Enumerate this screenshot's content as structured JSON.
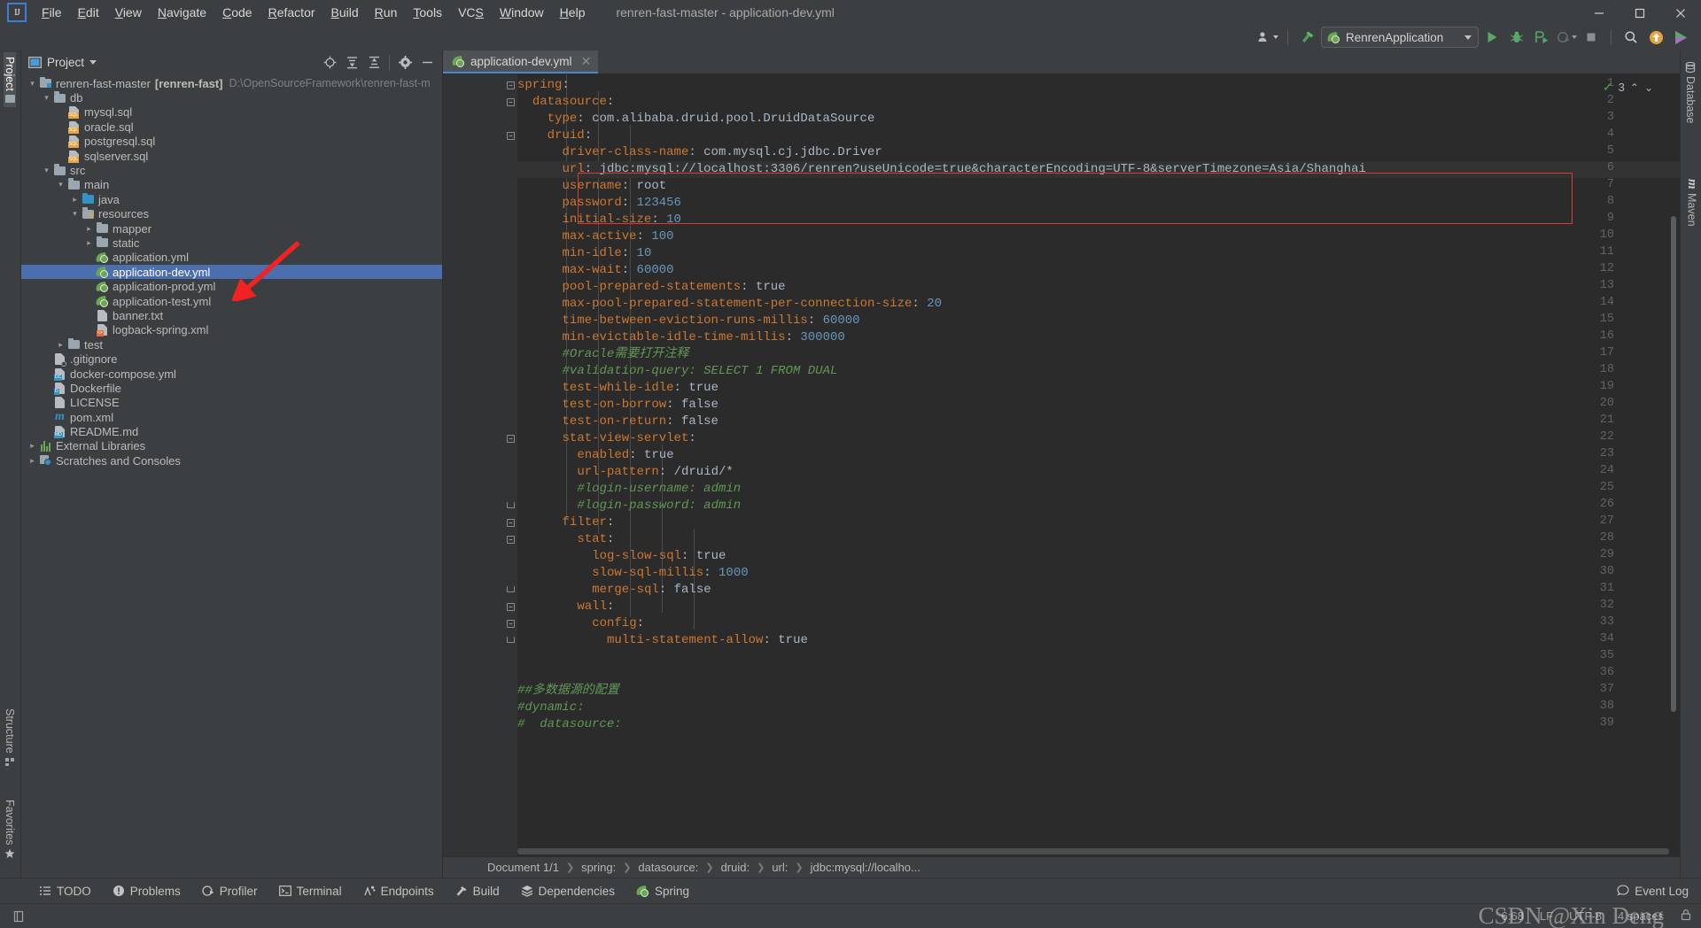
{
  "window": {
    "title": "renren-fast-master - application-dev.yml",
    "minimize": "─",
    "maximize": "☐",
    "close": "✕"
  },
  "menu": {
    "items": [
      "File",
      "Edit",
      "View",
      "Navigate",
      "Code",
      "Refactor",
      "Build",
      "Run",
      "Tools",
      "VCS",
      "Window",
      "Help"
    ]
  },
  "navbar": {
    "crumbs": [
      "renren-fast-master",
      "src",
      "main",
      "resources",
      "application-dev.yml"
    ]
  },
  "toolbar": {
    "run_config": "RenrenApplication",
    "icons": [
      "user-settings-icon",
      "hammer-build-icon",
      "run-icon",
      "debug-icon",
      "run-coverage-icon",
      "profile-icon",
      "stop-icon",
      "search-everywhere-icon",
      "update-icon",
      "ide-assistant-icon"
    ]
  },
  "left_strip": {
    "project": "Project",
    "structure": "Structure",
    "favorites": "Favorites"
  },
  "right_strip": {
    "database": "Database",
    "maven": "Maven"
  },
  "project_panel": {
    "title": "Project",
    "toolbar_icons": [
      "locate-icon",
      "expand-all-icon",
      "collapse-all-icon",
      "settings-gear-icon",
      "hide-icon"
    ],
    "tree": [
      {
        "indent": 0,
        "arrow": "down",
        "icon": "module-icon",
        "label": "renren-fast-master",
        "bold": "[renren-fast]",
        "path": "D:\\OpenSourceFramework\\renren-fast-m"
      },
      {
        "indent": 1,
        "arrow": "down",
        "icon": "folder-icon",
        "label": "db"
      },
      {
        "indent": 2,
        "arrow": "none",
        "icon": "sql-file-icon",
        "label": "mysql.sql"
      },
      {
        "indent": 2,
        "arrow": "none",
        "icon": "sql-file-icon",
        "label": "oracle.sql"
      },
      {
        "indent": 2,
        "arrow": "none",
        "icon": "sql-file-icon",
        "label": "postgresql.sql"
      },
      {
        "indent": 2,
        "arrow": "none",
        "icon": "sql-file-icon",
        "label": "sqlserver.sql"
      },
      {
        "indent": 1,
        "arrow": "down",
        "icon": "folder-icon",
        "label": "src"
      },
      {
        "indent": 2,
        "arrow": "down",
        "icon": "folder-icon",
        "label": "main"
      },
      {
        "indent": 3,
        "arrow": "right",
        "icon": "source-folder-icon",
        "label": "java"
      },
      {
        "indent": 3,
        "arrow": "down",
        "icon": "resource-folder-icon",
        "label": "resources"
      },
      {
        "indent": 4,
        "arrow": "right",
        "icon": "folder-icon",
        "label": "mapper"
      },
      {
        "indent": 4,
        "arrow": "right",
        "icon": "folder-icon",
        "label": "static"
      },
      {
        "indent": 4,
        "arrow": "none",
        "icon": "spring-yaml-icon",
        "label": "application.yml"
      },
      {
        "indent": 4,
        "arrow": "none",
        "icon": "spring-yaml-icon",
        "label": "application-dev.yml",
        "selected": true
      },
      {
        "indent": 4,
        "arrow": "none",
        "icon": "spring-yaml-icon",
        "label": "application-prod.yml"
      },
      {
        "indent": 4,
        "arrow": "none",
        "icon": "spring-yaml-icon",
        "label": "application-test.yml"
      },
      {
        "indent": 4,
        "arrow": "none",
        "icon": "text-file-icon",
        "label": "banner.txt"
      },
      {
        "indent": 4,
        "arrow": "none",
        "icon": "xml-file-icon",
        "label": "logback-spring.xml"
      },
      {
        "indent": 2,
        "arrow": "right",
        "icon": "folder-icon",
        "label": "test"
      },
      {
        "indent": 1,
        "arrow": "none",
        "icon": "gitignore-file-icon",
        "label": ".gitignore"
      },
      {
        "indent": 1,
        "arrow": "none",
        "icon": "docker-compose-file-icon",
        "label": "docker-compose.yml"
      },
      {
        "indent": 1,
        "arrow": "none",
        "icon": "dockerfile-icon",
        "label": "Dockerfile"
      },
      {
        "indent": 1,
        "arrow": "none",
        "icon": "license-file-icon",
        "label": "LICENSE"
      },
      {
        "indent": 1,
        "arrow": "none",
        "icon": "maven-pom-icon",
        "label": "pom.xml"
      },
      {
        "indent": 1,
        "arrow": "none",
        "icon": "markdown-file-icon",
        "label": "README.md"
      },
      {
        "indent": 0,
        "arrow": "right",
        "icon": "libraries-icon",
        "label": "External Libraries"
      },
      {
        "indent": 0,
        "arrow": "right",
        "icon": "scratches-icon",
        "label": "Scratches and Consoles"
      }
    ]
  },
  "editor": {
    "tab": "application-dev.yml",
    "tab_close": "✕",
    "inspection_count": "3",
    "lines": [
      {
        "n": 1,
        "fold": "minus",
        "indent": 0,
        "tokens": [
          {
            "t": "spring",
            "c": "k"
          },
          {
            "t": ":",
            "c": "p"
          }
        ]
      },
      {
        "n": 2,
        "fold": "minus",
        "indent": 2,
        "tokens": [
          {
            "t": "datasource",
            "c": "k"
          },
          {
            "t": ":",
            "c": "p"
          }
        ]
      },
      {
        "n": 3,
        "fold": "",
        "indent": 4,
        "tokens": [
          {
            "t": "type",
            "c": "k"
          },
          {
            "t": ": ",
            "c": "p"
          },
          {
            "t": "com.alibaba.druid.pool.DruidDataSource",
            "c": "v"
          }
        ]
      },
      {
        "n": 4,
        "fold": "minus",
        "indent": 4,
        "tokens": [
          {
            "t": "druid",
            "c": "k"
          },
          {
            "t": ":",
            "c": "p"
          }
        ]
      },
      {
        "n": 5,
        "fold": "",
        "indent": 6,
        "tokens": [
          {
            "t": "driver-class-name",
            "c": "k"
          },
          {
            "t": ": ",
            "c": "p"
          },
          {
            "t": "com.mysql.cj.jdbc.Driver",
            "c": "v"
          }
        ]
      },
      {
        "n": 6,
        "fold": "",
        "indent": 6,
        "current": true,
        "tokens": [
          {
            "t": "url",
            "c": "k"
          },
          {
            "t": ": ",
            "c": "p"
          },
          {
            "t": "jdbc:mysql://localhost:3306/renren?useUnicode=true&characterEncoding=UTF-8&serverTimezone=Asia/Shanghai",
            "c": "v"
          }
        ]
      },
      {
        "n": 7,
        "fold": "",
        "indent": 6,
        "tokens": [
          {
            "t": "username",
            "c": "k"
          },
          {
            "t": ": ",
            "c": "p"
          },
          {
            "t": "root",
            "c": "v"
          }
        ]
      },
      {
        "n": 8,
        "fold": "",
        "indent": 6,
        "tokens": [
          {
            "t": "password",
            "c": "k"
          },
          {
            "t": ": ",
            "c": "p"
          },
          {
            "t": "123456",
            "c": "n"
          }
        ]
      },
      {
        "n": 9,
        "fold": "",
        "indent": 6,
        "tokens": [
          {
            "t": "initial-size",
            "c": "k"
          },
          {
            "t": ": ",
            "c": "p"
          },
          {
            "t": "10",
            "c": "n"
          }
        ]
      },
      {
        "n": 10,
        "fold": "",
        "indent": 6,
        "tokens": [
          {
            "t": "max-active",
            "c": "k"
          },
          {
            "t": ": ",
            "c": "p"
          },
          {
            "t": "100",
            "c": "n"
          }
        ]
      },
      {
        "n": 11,
        "fold": "",
        "indent": 6,
        "tokens": [
          {
            "t": "min-idle",
            "c": "k"
          },
          {
            "t": ": ",
            "c": "p"
          },
          {
            "t": "10",
            "c": "n"
          }
        ]
      },
      {
        "n": 12,
        "fold": "",
        "indent": 6,
        "tokens": [
          {
            "t": "max-wait",
            "c": "k"
          },
          {
            "t": ": ",
            "c": "p"
          },
          {
            "t": "60000",
            "c": "n"
          }
        ]
      },
      {
        "n": 13,
        "fold": "",
        "indent": 6,
        "tokens": [
          {
            "t": "pool-prepared-statements",
            "c": "k"
          },
          {
            "t": ": ",
            "c": "p"
          },
          {
            "t": "true",
            "c": "v"
          }
        ]
      },
      {
        "n": 14,
        "fold": "",
        "indent": 6,
        "tokens": [
          {
            "t": "max-pool-prepared-statement-per-connection-size",
            "c": "k"
          },
          {
            "t": ": ",
            "c": "p"
          },
          {
            "t": "20",
            "c": "n"
          }
        ]
      },
      {
        "n": 15,
        "fold": "",
        "indent": 6,
        "tokens": [
          {
            "t": "time-between-eviction-runs-millis",
            "c": "k"
          },
          {
            "t": ": ",
            "c": "p"
          },
          {
            "t": "60000",
            "c": "n"
          }
        ]
      },
      {
        "n": 16,
        "fold": "",
        "indent": 6,
        "tokens": [
          {
            "t": "min-evictable-idle-time-millis",
            "c": "k"
          },
          {
            "t": ": ",
            "c": "p"
          },
          {
            "t": "300000",
            "c": "n"
          }
        ]
      },
      {
        "n": 17,
        "fold": "",
        "indent": 6,
        "tokens": [
          {
            "t": "#Oracle需要打开注释",
            "c": "c"
          }
        ]
      },
      {
        "n": 18,
        "fold": "",
        "indent": 6,
        "tokens": [
          {
            "t": "#validation-query: SELECT 1 FROM DUAL",
            "c": "c"
          }
        ]
      },
      {
        "n": 19,
        "fold": "",
        "indent": 6,
        "tokens": [
          {
            "t": "test-while-idle",
            "c": "k"
          },
          {
            "t": ": ",
            "c": "p"
          },
          {
            "t": "true",
            "c": "v"
          }
        ]
      },
      {
        "n": 20,
        "fold": "",
        "indent": 6,
        "tokens": [
          {
            "t": "test-on-borrow",
            "c": "k"
          },
          {
            "t": ": ",
            "c": "p"
          },
          {
            "t": "false",
            "c": "v"
          }
        ]
      },
      {
        "n": 21,
        "fold": "",
        "indent": 6,
        "tokens": [
          {
            "t": "test-on-return",
            "c": "k"
          },
          {
            "t": ": ",
            "c": "p"
          },
          {
            "t": "false",
            "c": "v"
          }
        ]
      },
      {
        "n": 22,
        "fold": "minus",
        "indent": 6,
        "tokens": [
          {
            "t": "stat-view-servlet",
            "c": "k"
          },
          {
            "t": ":",
            "c": "p"
          }
        ]
      },
      {
        "n": 23,
        "fold": "",
        "indent": 8,
        "tokens": [
          {
            "t": "enabled",
            "c": "k"
          },
          {
            "t": ": ",
            "c": "p"
          },
          {
            "t": "true",
            "c": "v"
          }
        ]
      },
      {
        "n": 24,
        "fold": "",
        "indent": 8,
        "tokens": [
          {
            "t": "url-pattern",
            "c": "k"
          },
          {
            "t": ": ",
            "c": "p"
          },
          {
            "t": "/druid/*",
            "c": "v"
          }
        ]
      },
      {
        "n": 25,
        "fold": "",
        "indent": 8,
        "tokens": [
          {
            "t": "#login-username: admin",
            "c": "c"
          }
        ]
      },
      {
        "n": 26,
        "fold": "end",
        "indent": 8,
        "tokens": [
          {
            "t": "#login-password: admin",
            "c": "c"
          }
        ]
      },
      {
        "n": 27,
        "fold": "minus",
        "indent": 6,
        "tokens": [
          {
            "t": "filter",
            "c": "k"
          },
          {
            "t": ":",
            "c": "p"
          }
        ]
      },
      {
        "n": 28,
        "fold": "minus",
        "indent": 8,
        "tokens": [
          {
            "t": "stat",
            "c": "k"
          },
          {
            "t": ":",
            "c": "p"
          }
        ]
      },
      {
        "n": 29,
        "fold": "",
        "indent": 10,
        "tokens": [
          {
            "t": "log-slow-sql",
            "c": "k"
          },
          {
            "t": ": ",
            "c": "p"
          },
          {
            "t": "true",
            "c": "v"
          }
        ]
      },
      {
        "n": 30,
        "fold": "",
        "indent": 10,
        "tokens": [
          {
            "t": "slow-sql-millis",
            "c": "k"
          },
          {
            "t": ": ",
            "c": "p"
          },
          {
            "t": "1000",
            "c": "n"
          }
        ]
      },
      {
        "n": 31,
        "fold": "end",
        "indent": 10,
        "tokens": [
          {
            "t": "merge-sql",
            "c": "k"
          },
          {
            "t": ": ",
            "c": "p"
          },
          {
            "t": "false",
            "c": "v"
          }
        ]
      },
      {
        "n": 32,
        "fold": "minus",
        "indent": 8,
        "tokens": [
          {
            "t": "wall",
            "c": "k"
          },
          {
            "t": ":",
            "c": "p"
          }
        ]
      },
      {
        "n": 33,
        "fold": "minus",
        "indent": 10,
        "tokens": [
          {
            "t": "config",
            "c": "k"
          },
          {
            "t": ":",
            "c": "p"
          }
        ]
      },
      {
        "n": 34,
        "fold": "end",
        "indent": 12,
        "tokens": [
          {
            "t": "multi-statement-allow",
            "c": "k"
          },
          {
            "t": ": ",
            "c": "p"
          },
          {
            "t": "true",
            "c": "v"
          }
        ]
      },
      {
        "n": 35,
        "fold": "",
        "indent": 0,
        "tokens": []
      },
      {
        "n": 36,
        "fold": "",
        "indent": 0,
        "tokens": []
      },
      {
        "n": 37,
        "fold": "",
        "indent": 0,
        "tokens": [
          {
            "t": "##多数据源的配置",
            "c": "c"
          }
        ]
      },
      {
        "n": 38,
        "fold": "",
        "indent": 0,
        "tokens": [
          {
            "t": "#dynamic:",
            "c": "c"
          }
        ]
      },
      {
        "n": 39,
        "fold": "",
        "indent": 0,
        "tokens": [
          {
            "t": "#  datasource:",
            "c": "c"
          }
        ]
      }
    ],
    "breadcrumb": [
      "Document 1/1",
      "spring:",
      "datasource:",
      "druid:",
      "url:",
      "jdbc:mysql://localho..."
    ]
  },
  "bottom_bar": {
    "items": [
      {
        "label": "TODO",
        "icon": "todo-list-icon"
      },
      {
        "label": "Problems",
        "icon": "problems-icon"
      },
      {
        "label": "Profiler",
        "icon": "profiler-icon"
      },
      {
        "label": "Terminal",
        "icon": "terminal-icon"
      },
      {
        "label": "Endpoints",
        "icon": "endpoints-icon"
      },
      {
        "label": "Build",
        "icon": "build-hammer-icon"
      },
      {
        "label": "Dependencies",
        "icon": "dependencies-icon"
      },
      {
        "label": "Spring",
        "icon": "spring-leaf-icon"
      }
    ],
    "event_log": "Event Log"
  },
  "status_bar": {
    "caret": "6:68",
    "line_sep": "LF",
    "encoding": "UTF-8",
    "indent": "4 spaces",
    "lock_icon": "lock-icon",
    "watermark": "CSDN @Xin Deng"
  },
  "colors": {
    "panel_bg": "#3c3f41",
    "editor_bg": "#2b2b2b",
    "gutter_bg": "#313335",
    "selection": "#4b6eaf",
    "key": "#cc7832",
    "value": "#a9b7c6",
    "number": "#6897bb",
    "comment": "#629755",
    "accent_red": "#e03a34",
    "accent_green": "#6aa84f",
    "tab_underline": "#4a88c7"
  }
}
